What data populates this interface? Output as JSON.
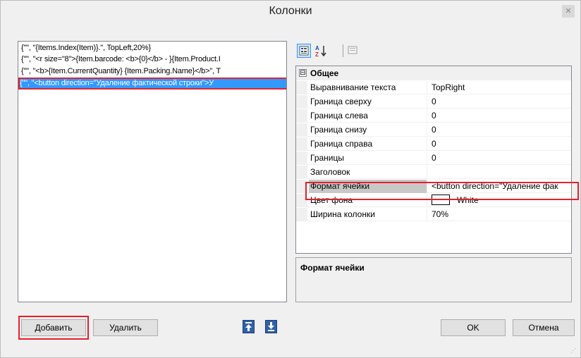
{
  "window": {
    "title": "Колонки",
    "close_icon": "close-icon"
  },
  "list": {
    "items": [
      "{\"\", \"{Items.Index(Item)}.\", TopLeft,20%}",
      "{\"\", \"<r size=\"8\">{Item.barcode: <b>{0}</b> - }{Item.Product.I",
      "{\"\", \"<b>{Item.CurrentQuantity} {Item.Packing.Name}</b>\", T",
      "{\"\", \"<button direction=\"Удаление фактической строки\">У"
    ],
    "selected_index": 3
  },
  "toolbar": {
    "categorized_icon": "categorized-icon",
    "alphabetical_icon": "sort-az-icon",
    "property_pages_icon": "property-pages-icon"
  },
  "grid": {
    "category": "Общее",
    "category_toggle": "⊟",
    "properties": [
      {
        "name": "Выравнивание текста",
        "value": "TopRight"
      },
      {
        "name": "Граница сверху",
        "value": "0"
      },
      {
        "name": "Граница слева",
        "value": "0"
      },
      {
        "name": "Граница снизу",
        "value": "0"
      },
      {
        "name": "Граница справа",
        "value": "0"
      },
      {
        "name": "Границы",
        "value": "0"
      },
      {
        "name": "Заголовок",
        "value": ""
      },
      {
        "name": "Формат ячейки",
        "value": "<button direction=\"Удаление фак"
      },
      {
        "name": "Цвет фона",
        "value": "White"
      },
      {
        "name": "Ширина колонки",
        "value": "70%"
      }
    ],
    "selected_property": "Формат ячейки"
  },
  "description": {
    "title": "Формат ячейки"
  },
  "buttons": {
    "add": "Добавить",
    "delete": "Удалить",
    "move_up_icon": "arrow-up-icon",
    "move_down_icon": "arrow-down-icon",
    "ok": "OK",
    "cancel": "Отмена"
  },
  "colors": {
    "selection": "#3399ff",
    "highlight": "#e5212b",
    "arrow_button": "#2f62a8"
  }
}
